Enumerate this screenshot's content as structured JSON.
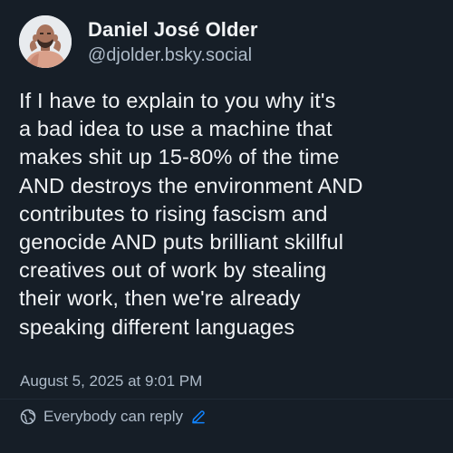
{
  "post": {
    "author": {
      "display_name": "Daniel José Older",
      "handle": "@djolder.bsky.social"
    },
    "text_lines": [
      "If I have to explain to you why it's",
      "a bad idea to use a machine that",
      "makes shit up 15-80% of the time",
      "AND destroys the environment AND",
      "contributes to rising fascism and",
      "genocide AND puts brilliant skillful",
      "creatives out of work by stealing",
      "their work, then we're already",
      "speaking different languages"
    ],
    "timestamp": "August 5, 2025 at 9:01 PM",
    "reply_setting": "Everybody can reply"
  },
  "icons": {
    "reply_setting_icon": "globe-icon",
    "edit_icon": "pencil-icon"
  },
  "colors": {
    "background": "#161e27",
    "text_primary": "#f1f3f5",
    "text_secondary": "#aebbc9",
    "accent": "#1083fe"
  }
}
